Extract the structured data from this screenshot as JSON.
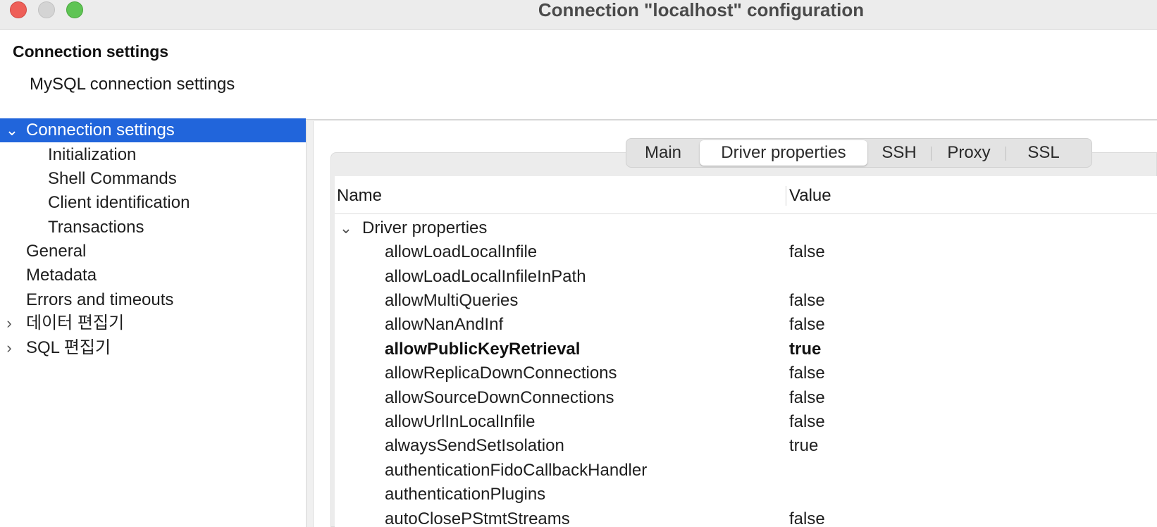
{
  "window": {
    "title": "Connection \"localhost\" configuration"
  },
  "header": {
    "title": "Connection settings",
    "description": "MySQL connection settings"
  },
  "sidebar": {
    "items": [
      {
        "label": "Connection settings",
        "expander": "⌄",
        "selected": true
      },
      {
        "label": "Initialization"
      },
      {
        "label": "Shell Commands"
      },
      {
        "label": "Client identification"
      },
      {
        "label": "Transactions"
      },
      {
        "label": "General"
      },
      {
        "label": "Metadata"
      },
      {
        "label": "Errors and timeouts"
      },
      {
        "label": "데이터 편집기",
        "expander": "›"
      },
      {
        "label": "SQL 편집기",
        "expander": "›"
      }
    ]
  },
  "tabs": {
    "items": [
      "Main",
      "Driver properties",
      "SSH",
      "Proxy",
      "SSL"
    ],
    "active": "Driver properties"
  },
  "table": {
    "columns": [
      "Name",
      "Value"
    ],
    "group": {
      "label": "Driver properties",
      "expander": "⌄"
    },
    "rows": [
      {
        "name": "allowLoadLocalInfile",
        "value": "false"
      },
      {
        "name": "allowLoadLocalInfileInPath",
        "value": ""
      },
      {
        "name": "allowMultiQueries",
        "value": "false"
      },
      {
        "name": "allowNanAndInf",
        "value": "false"
      },
      {
        "name": "allowPublicKeyRetrieval",
        "value": "true",
        "modified": true
      },
      {
        "name": "allowReplicaDownConnections",
        "value": "false"
      },
      {
        "name": "allowSourceDownConnections",
        "value": "false"
      },
      {
        "name": "allowUrlInLocalInfile",
        "value": "false"
      },
      {
        "name": "alwaysSendSetIsolation",
        "value": "true"
      },
      {
        "name": "authenticationFidoCallbackHandler",
        "value": ""
      },
      {
        "name": "authenticationPlugins",
        "value": ""
      },
      {
        "name": "autoClosePStmtStreams",
        "value": "false"
      }
    ]
  },
  "colors": {
    "selection": "#2165db",
    "titlebar": "#ececec",
    "close": "#ee5f58",
    "minimize": "#d4d4d4",
    "maximize": "#5fc454"
  }
}
